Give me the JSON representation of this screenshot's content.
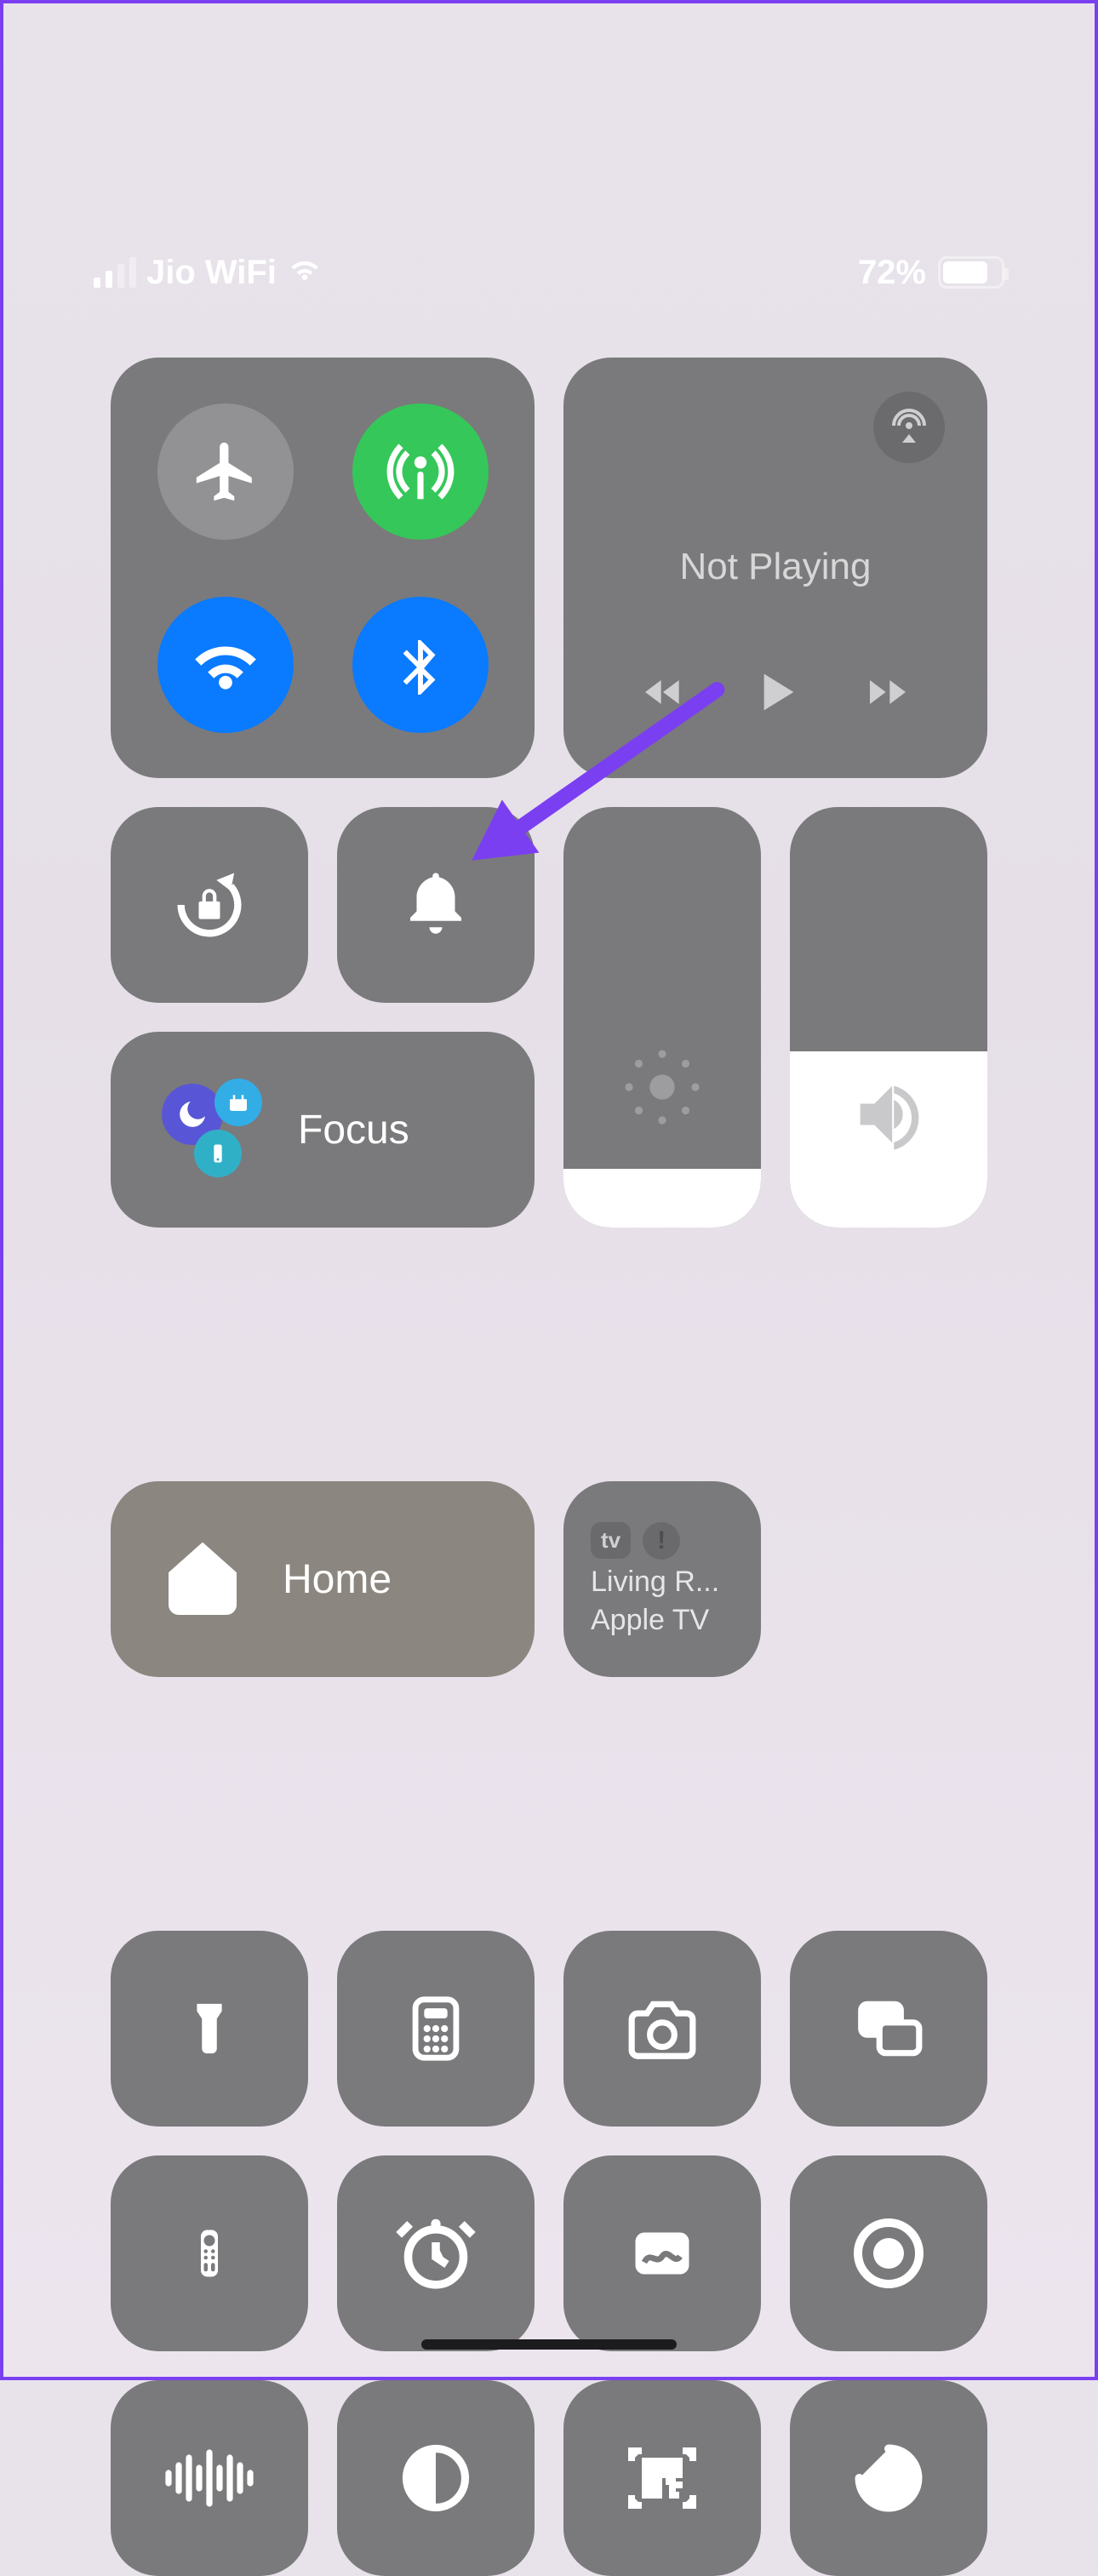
{
  "status": {
    "carrier": "Jio WiFi",
    "battery_pct": "72%"
  },
  "media": {
    "title": "Not Playing"
  },
  "focus": {
    "label": "Focus"
  },
  "home": {
    "label": "Home"
  },
  "appletv": {
    "badge": "tv",
    "line1": "Living R...",
    "line2": "Apple TV"
  },
  "sliders": {
    "brightness_pct": 14,
    "volume_pct": 42
  },
  "connectivity": {
    "airplane": false,
    "cellular": true,
    "wifi": true,
    "bluetooth": true
  },
  "colors": {
    "accent_blue": "#0a7aff",
    "accent_green": "#35c759",
    "annotation": "#7b3ff2"
  },
  "tiles": [
    "flashlight",
    "calculator",
    "camera",
    "screen-mirroring",
    "apple-tv-remote",
    "alarm",
    "freeform",
    "screen-record",
    "sound-recognition",
    "dark-mode",
    "qr-scanner",
    "timer"
  ]
}
